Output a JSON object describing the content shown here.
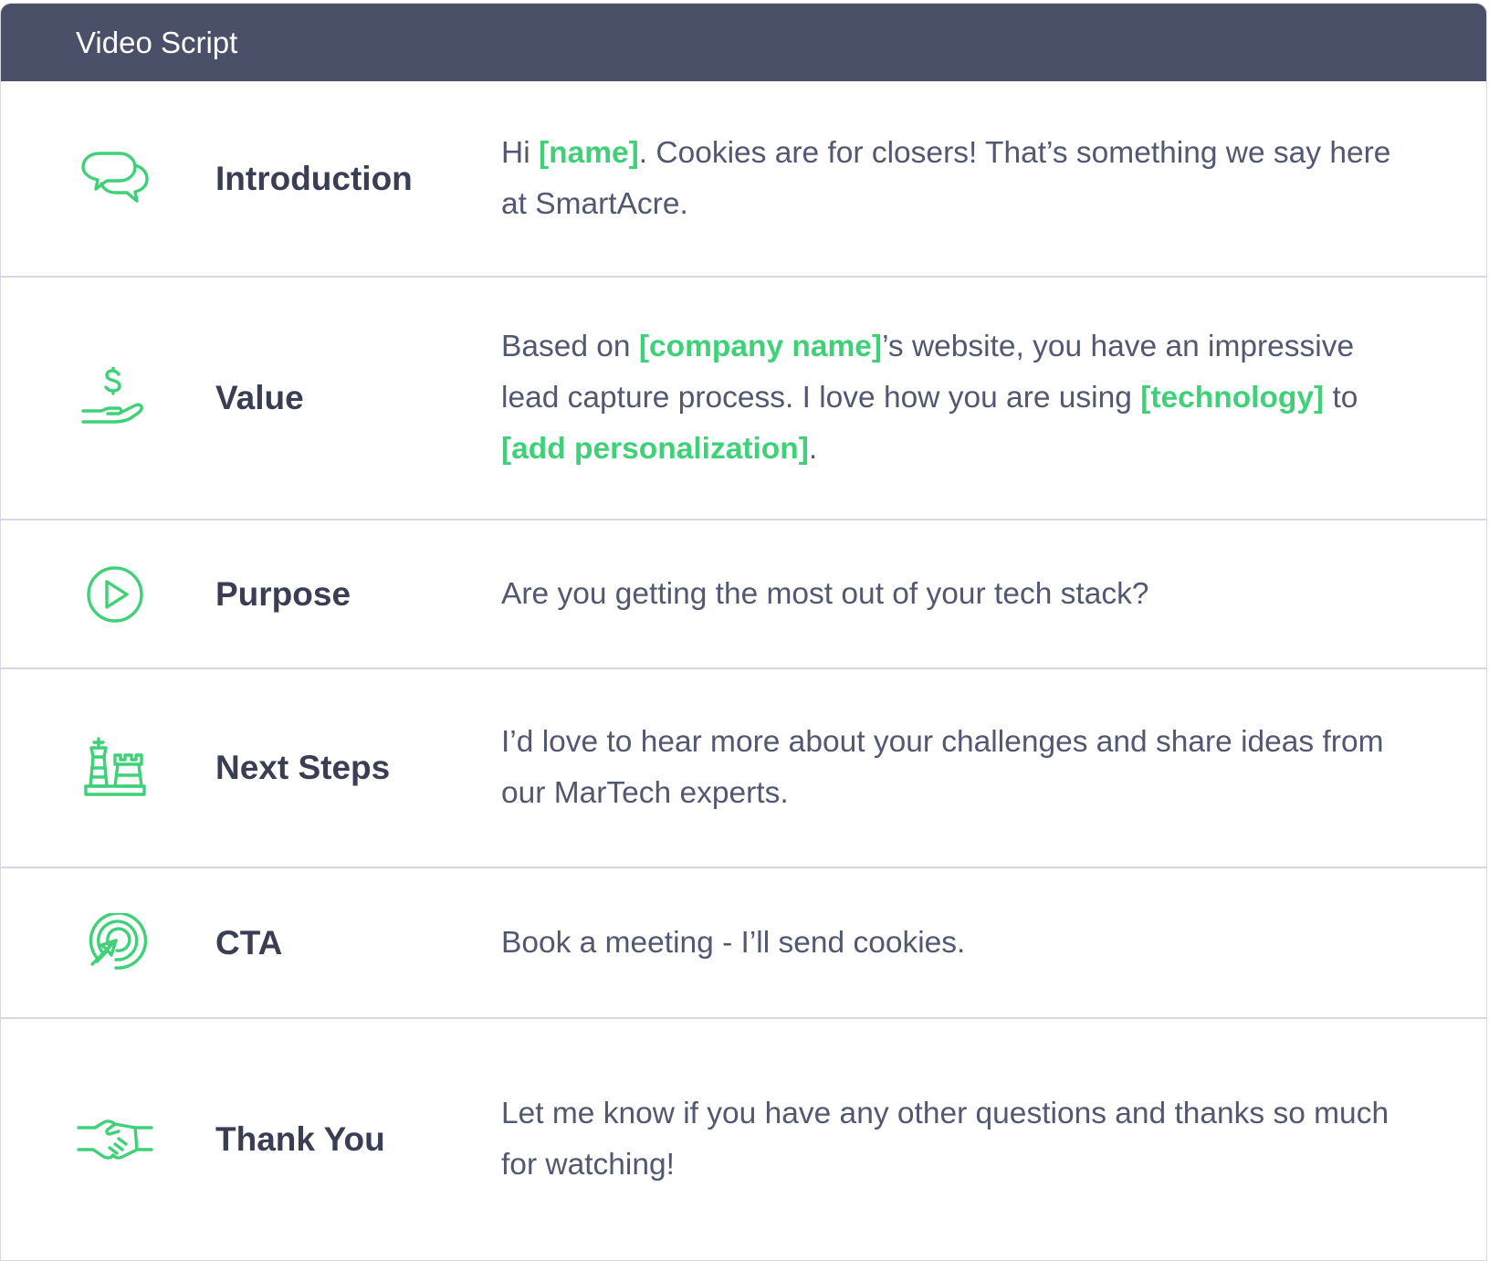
{
  "header": {
    "title": "Video Script"
  },
  "accent_color": "#3fd178",
  "header_color": "#495068",
  "rows": [
    {
      "icon": "chat-bubbles-icon",
      "label": "Introduction",
      "t1": "Hi ",
      "t2": "[name]",
      "t3": ". Cookies are for closers! That’s something we say here at SmartAcre."
    },
    {
      "icon": "dollar-hand-icon",
      "label": "Value",
      "t1": "Based on ",
      "t2": "[company name]",
      "t3": "’s website, you have an impressive lead capture process. I love how you are using ",
      "t4": "[technology]",
      "t5": " to ",
      "t6": "[add personalization]",
      "t7": "."
    },
    {
      "icon": "play-circle-icon",
      "label": "Purpose",
      "t1": "Are you getting the most out of your tech stack?"
    },
    {
      "icon": "chess-pieces-icon",
      "label": "Next Steps",
      "t1": "I’d love to hear more about your challenges and share ideas from our MarTech experts."
    },
    {
      "icon": "target-cursor-icon",
      "label": "CTA",
      "t1": "Book a meeting - I’ll send cookies."
    },
    {
      "icon": "handshake-icon",
      "label": "Thank You",
      "t1": "Let me know if you have any other questions and thanks so much for watching!"
    }
  ]
}
